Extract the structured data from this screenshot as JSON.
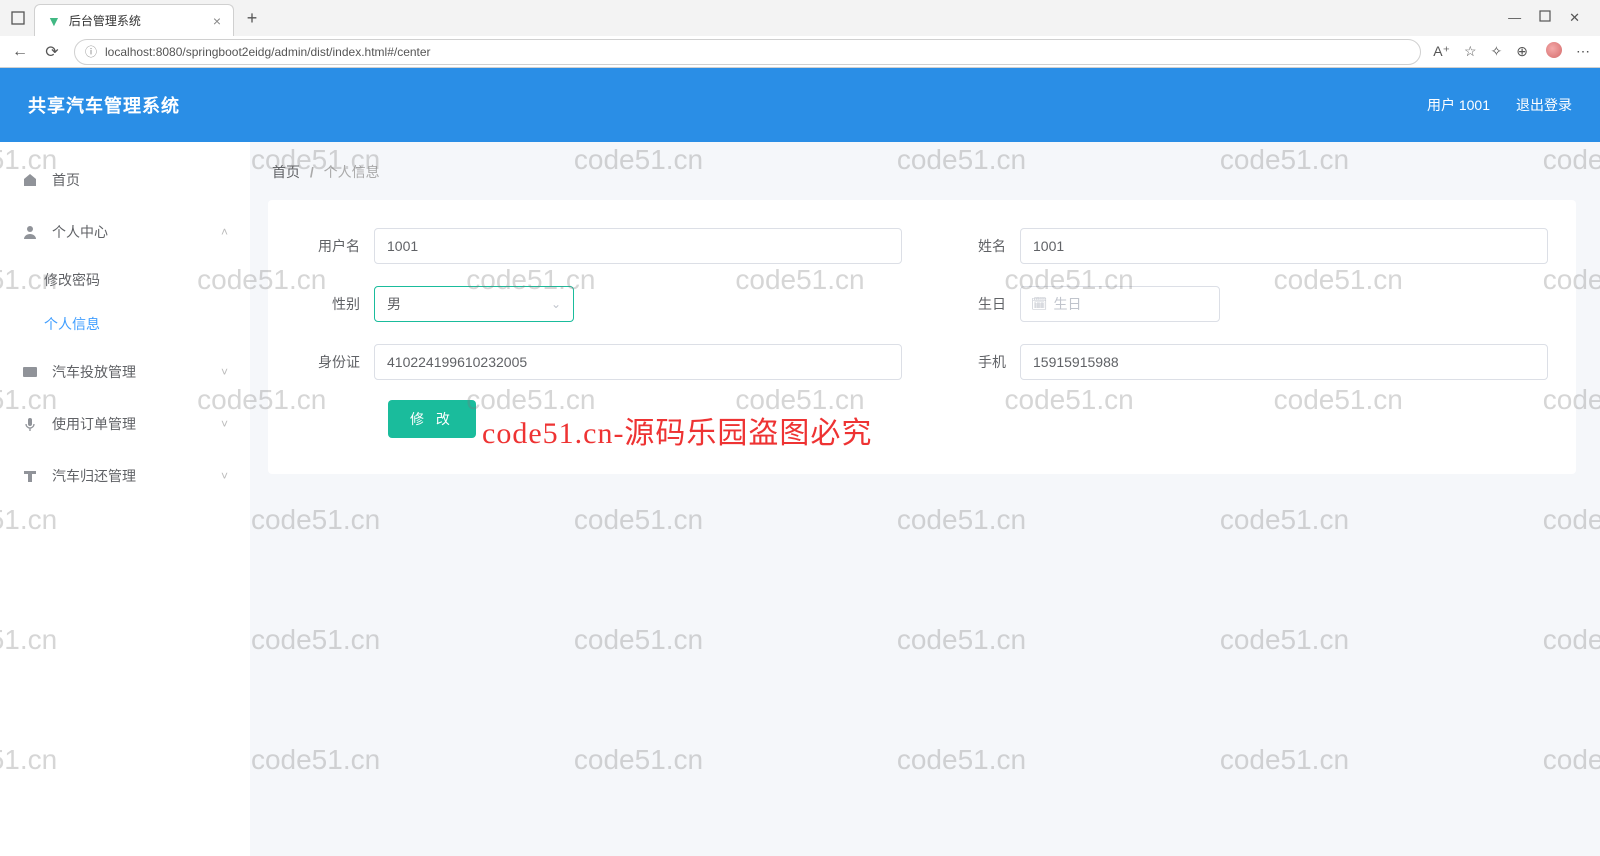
{
  "browser": {
    "tab_title": "后台管理系统",
    "url": "localhost:8080/springboot2eidg/admin/dist/index.html#/center"
  },
  "header": {
    "brand": "共享汽车管理系统",
    "user_label": "用户 1001",
    "logout": "退出登录"
  },
  "sidebar": {
    "home": "首页",
    "personal_center": "个人中心",
    "change_password": "修改密码",
    "personal_info": "个人信息",
    "car_deploy": "汽车投放管理",
    "order_mgmt": "使用订单管理",
    "car_return": "汽车归还管理"
  },
  "breadcrumb": {
    "home": "首页",
    "current": "个人信息"
  },
  "form": {
    "labels": {
      "username": "用户名",
      "name": "姓名",
      "gender": "性别",
      "birthday": "生日",
      "idcard": "身份证",
      "phone": "手机"
    },
    "values": {
      "username": "1001",
      "name": "1001",
      "gender": "男",
      "birthday_placeholder": "生日",
      "idcard": "410224199610232005",
      "phone": "15915915988"
    },
    "submit": "修 改"
  },
  "watermark": {
    "text": "code51.cn",
    "red": "code51.cn-源码乐园盗图必究"
  }
}
